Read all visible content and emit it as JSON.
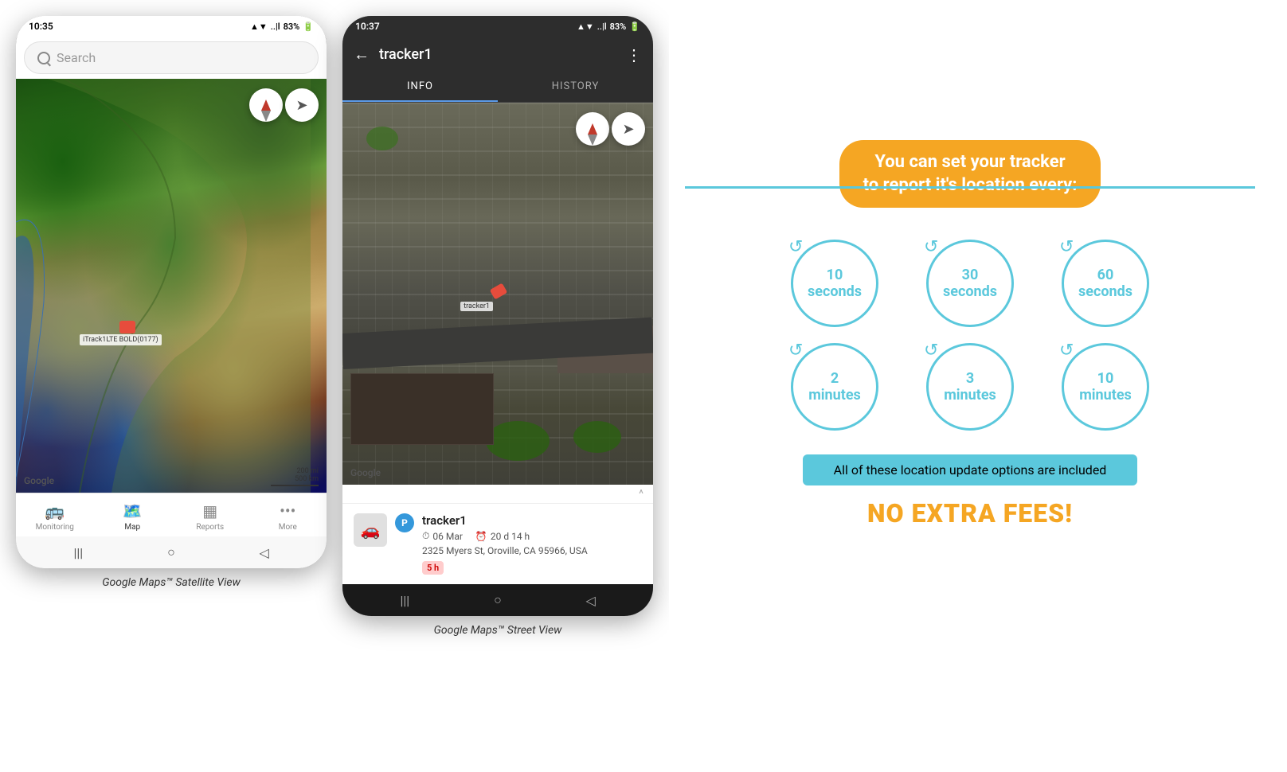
{
  "phone1": {
    "status_bar": {
      "time": "10:35",
      "signal": "▲▼ ..|l",
      "battery": "83%"
    },
    "search_placeholder": "Search",
    "google_label": "Google",
    "scale_200mi": "200 mi",
    "scale_500km": "500 km",
    "car_label": "iTrack1LTE BOLD(0177)",
    "nav_items": [
      {
        "icon": "🚌",
        "label": "Monitoring",
        "active": false
      },
      {
        "icon": "🗺",
        "label": "Map",
        "active": true
      },
      {
        "icon": "📊",
        "label": "Reports",
        "active": false
      },
      {
        "icon": "•••",
        "label": "More",
        "active": false
      }
    ],
    "caption": "Google Maps™ Satellite View"
  },
  "phone2": {
    "status_bar": {
      "time": "10:37",
      "signal": "▲▼ ..|l",
      "battery": "83%"
    },
    "header": {
      "back_icon": "←",
      "title": "tracker1",
      "more_icon": "⋮"
    },
    "tabs": [
      {
        "label": "INFO",
        "active": true
      },
      {
        "label": "HISTORY",
        "active": false
      }
    ],
    "google_label": "Google",
    "drag_icon": "^",
    "tracker_info": {
      "name": "tracker1",
      "date": "06 Mar",
      "duration": "20 d 14 h",
      "address": "2325 Myers St, Oroville, CA 95966, USA",
      "time_badge": "5 h"
    },
    "car_label": "tracker1",
    "caption": "Google Maps™ Street View"
  },
  "info_graphic": {
    "banner_line1": "You can set your tracker",
    "banner_line2": "to report it's location every:",
    "circles": [
      {
        "number": "10",
        "unit": "seconds"
      },
      {
        "number": "30",
        "unit": "seconds"
      },
      {
        "number": "60",
        "unit": "seconds"
      },
      {
        "number": "2",
        "unit": "minutes"
      },
      {
        "number": "3",
        "unit": "minutes"
      },
      {
        "number": "10",
        "unit": "minutes"
      }
    ],
    "included_text": "All of these location update options are included",
    "no_fees_text": "NO EXTRA FEES!",
    "accent_color": "#f5a623",
    "teal_color": "#5bc8dc"
  }
}
